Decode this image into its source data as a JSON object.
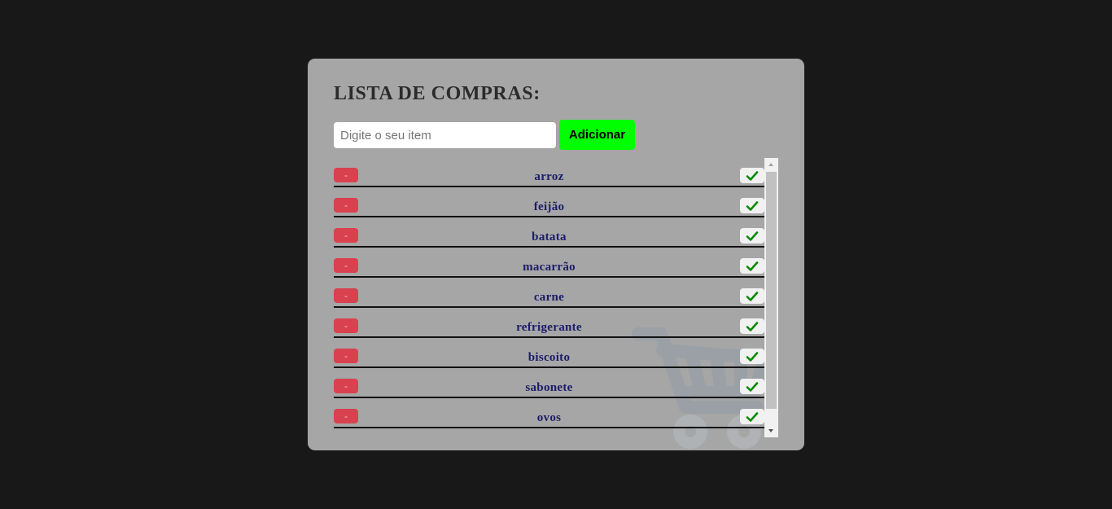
{
  "app": {
    "title": "LISTA DE COMPRAS:"
  },
  "form": {
    "input_placeholder": "Digite o seu item",
    "input_value": "",
    "add_label": "Adicionar"
  },
  "list": {
    "remove_label": "-",
    "items": [
      {
        "name": "arroz"
      },
      {
        "name": "feijão"
      },
      {
        "name": "batata"
      },
      {
        "name": "macarrão"
      },
      {
        "name": "carne"
      },
      {
        "name": "refrigerante"
      },
      {
        "name": "biscoito"
      },
      {
        "name": "sabonete"
      },
      {
        "name": "ovos"
      }
    ]
  },
  "icons": {
    "remove": "minus-icon",
    "check": "checkmark-icon",
    "watermark": "shopping-cart-icon"
  },
  "colors": {
    "background": "#181818",
    "card": "#a6a6a6",
    "add_button": "#00ff00",
    "remove_button": "#d9414f",
    "item_text": "#1c1c6a",
    "check": "#0a8a0a"
  }
}
